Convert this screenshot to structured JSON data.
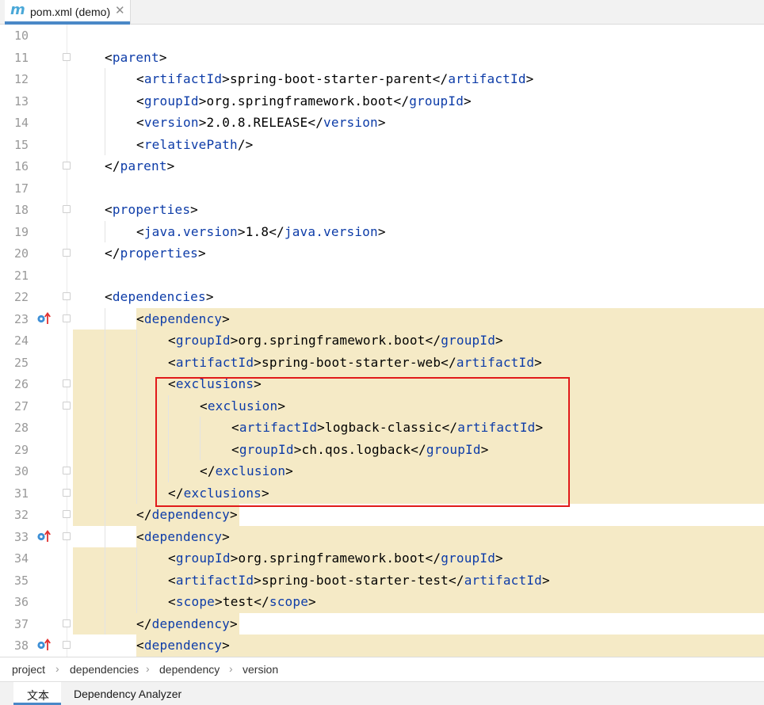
{
  "tab": {
    "icon": "maven-m-icon",
    "icon_glyph": "m",
    "title": "pom.xml (demo)",
    "close_glyph": "✕",
    "accent": "#4a88c7"
  },
  "colors": {
    "tag": "#0d3ca8",
    "text": "#000000",
    "highlight": "#f5eac6",
    "line_number": "#999999",
    "annotation_box": "#e11a1a"
  },
  "lines": [
    {
      "n": "10",
      "indent": 0,
      "parts": []
    },
    {
      "n": "11",
      "indent": 1,
      "parts": [
        {
          "c": "p",
          "v": "<"
        },
        {
          "c": "t",
          "v": "parent"
        },
        {
          "c": "p",
          "v": ">"
        }
      ]
    },
    {
      "n": "12",
      "indent": 2,
      "parts": [
        {
          "c": "p",
          "v": "<"
        },
        {
          "c": "t",
          "v": "artifactId"
        },
        {
          "c": "p",
          "v": ">"
        },
        {
          "c": "x",
          "v": "spring-boot-starter-parent"
        },
        {
          "c": "p",
          "v": "</"
        },
        {
          "c": "t",
          "v": "artifactId"
        },
        {
          "c": "p",
          "v": ">"
        }
      ]
    },
    {
      "n": "13",
      "indent": 2,
      "parts": [
        {
          "c": "p",
          "v": "<"
        },
        {
          "c": "t",
          "v": "groupId"
        },
        {
          "c": "p",
          "v": ">"
        },
        {
          "c": "x",
          "v": "org.springframework.boot"
        },
        {
          "c": "p",
          "v": "</"
        },
        {
          "c": "t",
          "v": "groupId"
        },
        {
          "c": "p",
          "v": ">"
        }
      ]
    },
    {
      "n": "14",
      "indent": 2,
      "parts": [
        {
          "c": "p",
          "v": "<"
        },
        {
          "c": "t",
          "v": "version"
        },
        {
          "c": "p",
          "v": ">"
        },
        {
          "c": "x",
          "v": "2.0.8.RELEASE"
        },
        {
          "c": "p",
          "v": "</"
        },
        {
          "c": "t",
          "v": "version"
        },
        {
          "c": "p",
          "v": ">"
        }
      ]
    },
    {
      "n": "15",
      "indent": 2,
      "parts": [
        {
          "c": "p",
          "v": "<"
        },
        {
          "c": "t",
          "v": "relativePath"
        },
        {
          "c": "p",
          "v": "/>"
        }
      ]
    },
    {
      "n": "16",
      "indent": 1,
      "parts": [
        {
          "c": "p",
          "v": "</"
        },
        {
          "c": "t",
          "v": "parent"
        },
        {
          "c": "p",
          "v": ">"
        }
      ]
    },
    {
      "n": "17",
      "indent": 0,
      "parts": []
    },
    {
      "n": "18",
      "indent": 1,
      "parts": [
        {
          "c": "p",
          "v": "<"
        },
        {
          "c": "t",
          "v": "properties"
        },
        {
          "c": "p",
          "v": ">"
        }
      ]
    },
    {
      "n": "19",
      "indent": 2,
      "parts": [
        {
          "c": "p",
          "v": "<"
        },
        {
          "c": "t",
          "v": "java.version"
        },
        {
          "c": "p",
          "v": ">"
        },
        {
          "c": "x",
          "v": "1.8"
        },
        {
          "c": "p",
          "v": "</"
        },
        {
          "c": "t",
          "v": "java.version"
        },
        {
          "c": "p",
          "v": ">"
        }
      ]
    },
    {
      "n": "20",
      "indent": 1,
      "parts": [
        {
          "c": "p",
          "v": "</"
        },
        {
          "c": "t",
          "v": "properties"
        },
        {
          "c": "p",
          "v": ">"
        }
      ]
    },
    {
      "n": "21",
      "indent": 0,
      "parts": []
    },
    {
      "n": "22",
      "indent": 1,
      "parts": [
        {
          "c": "p",
          "v": "<"
        },
        {
          "c": "t",
          "v": "dependencies"
        },
        {
          "c": "p",
          "v": ">"
        }
      ]
    },
    {
      "n": "23",
      "indent": 2,
      "parts": [
        {
          "c": "p",
          "v": "<"
        },
        {
          "c": "t",
          "v": "dependency"
        },
        {
          "c": "p",
          "v": ">"
        }
      ]
    },
    {
      "n": "24",
      "indent": 3,
      "parts": [
        {
          "c": "p",
          "v": "<"
        },
        {
          "c": "t",
          "v": "groupId"
        },
        {
          "c": "p",
          "v": ">"
        },
        {
          "c": "x",
          "v": "org.springframework.boot"
        },
        {
          "c": "p",
          "v": "</"
        },
        {
          "c": "t",
          "v": "groupId"
        },
        {
          "c": "p",
          "v": ">"
        }
      ]
    },
    {
      "n": "25",
      "indent": 3,
      "parts": [
        {
          "c": "p",
          "v": "<"
        },
        {
          "c": "t",
          "v": "artifactId"
        },
        {
          "c": "p",
          "v": ">"
        },
        {
          "c": "x",
          "v": "spring-boot-starter-web"
        },
        {
          "c": "p",
          "v": "</"
        },
        {
          "c": "t",
          "v": "artifactId"
        },
        {
          "c": "p",
          "v": ">"
        }
      ]
    },
    {
      "n": "26",
      "indent": 3,
      "parts": [
        {
          "c": "p",
          "v": "<"
        },
        {
          "c": "t",
          "v": "exclusions"
        },
        {
          "c": "p",
          "v": ">"
        }
      ]
    },
    {
      "n": "27",
      "indent": 4,
      "parts": [
        {
          "c": "p",
          "v": "<"
        },
        {
          "c": "t",
          "v": "exclusion"
        },
        {
          "c": "p",
          "v": ">"
        }
      ]
    },
    {
      "n": "28",
      "indent": 5,
      "parts": [
        {
          "c": "p",
          "v": "<"
        },
        {
          "c": "t",
          "v": "artifactId"
        },
        {
          "c": "p",
          "v": ">"
        },
        {
          "c": "x",
          "v": "logback-classic"
        },
        {
          "c": "p",
          "v": "</"
        },
        {
          "c": "t",
          "v": "artifactId"
        },
        {
          "c": "p",
          "v": ">"
        }
      ]
    },
    {
      "n": "29",
      "indent": 5,
      "parts": [
        {
          "c": "p",
          "v": "<"
        },
        {
          "c": "t",
          "v": "groupId"
        },
        {
          "c": "p",
          "v": ">"
        },
        {
          "c": "x",
          "v": "ch.qos.logback"
        },
        {
          "c": "p",
          "v": "</"
        },
        {
          "c": "t",
          "v": "groupId"
        },
        {
          "c": "p",
          "v": ">"
        }
      ]
    },
    {
      "n": "30",
      "indent": 4,
      "parts": [
        {
          "c": "p",
          "v": "</"
        },
        {
          "c": "t",
          "v": "exclusion"
        },
        {
          "c": "p",
          "v": ">"
        }
      ]
    },
    {
      "n": "31",
      "indent": 3,
      "parts": [
        {
          "c": "p",
          "v": "</"
        },
        {
          "c": "t",
          "v": "exclusions"
        },
        {
          "c": "p",
          "v": ">"
        }
      ]
    },
    {
      "n": "32",
      "indent": 2,
      "parts": [
        {
          "c": "p",
          "v": "</"
        },
        {
          "c": "t",
          "v": "dependency"
        },
        {
          "c": "p",
          "v": ">"
        }
      ]
    },
    {
      "n": "33",
      "indent": 2,
      "parts": [
        {
          "c": "p",
          "v": "<"
        },
        {
          "c": "t",
          "v": "dependency"
        },
        {
          "c": "p",
          "v": ">"
        }
      ]
    },
    {
      "n": "34",
      "indent": 3,
      "parts": [
        {
          "c": "p",
          "v": "<"
        },
        {
          "c": "t",
          "v": "groupId"
        },
        {
          "c": "p",
          "v": ">"
        },
        {
          "c": "x",
          "v": "org.springframework.boot"
        },
        {
          "c": "p",
          "v": "</"
        },
        {
          "c": "t",
          "v": "groupId"
        },
        {
          "c": "p",
          "v": ">"
        }
      ]
    },
    {
      "n": "35",
      "indent": 3,
      "parts": [
        {
          "c": "p",
          "v": "<"
        },
        {
          "c": "t",
          "v": "artifactId"
        },
        {
          "c": "p",
          "v": ">"
        },
        {
          "c": "x",
          "v": "spring-boot-starter-test"
        },
        {
          "c": "p",
          "v": "</"
        },
        {
          "c": "t",
          "v": "artifactId"
        },
        {
          "c": "p",
          "v": ">"
        }
      ]
    },
    {
      "n": "36",
      "indent": 3,
      "parts": [
        {
          "c": "p",
          "v": "<"
        },
        {
          "c": "t",
          "v": "scope"
        },
        {
          "c": "p",
          "v": ">"
        },
        {
          "c": "x",
          "v": "test"
        },
        {
          "c": "p",
          "v": "</"
        },
        {
          "c": "t",
          "v": "scope"
        },
        {
          "c": "p",
          "v": ">"
        }
      ]
    },
    {
      "n": "37",
      "indent": 2,
      "parts": [
        {
          "c": "p",
          "v": "</"
        },
        {
          "c": "t",
          "v": "dependency"
        },
        {
          "c": "p",
          "v": ">"
        }
      ]
    },
    {
      "n": "38",
      "indent": 2,
      "parts": [
        {
          "c": "p",
          "v": "<"
        },
        {
          "c": "t",
          "v": "dependency"
        },
        {
          "c": "p",
          "v": ">"
        }
      ]
    }
  ],
  "fold_markers": [
    "11",
    "16",
    "18",
    "20",
    "22",
    "23",
    "26",
    "27",
    "30",
    "31",
    "32",
    "33",
    "37",
    "38"
  ],
  "gutter_icons": {
    "23": "overrides-dependency-icon",
    "33": "overrides-dependency-icon",
    "38": "overrides-dependency-icon"
  },
  "highlighted_lines": [
    "23",
    "24",
    "25",
    "26",
    "27",
    "28",
    "29",
    "30",
    "31",
    "32",
    "33",
    "34",
    "35",
    "36",
    "37",
    "38"
  ],
  "annotation": {
    "label": "red-annotation-box",
    "lines": [
      "26",
      "31"
    ]
  },
  "breadcrumb": {
    "items": [
      "project",
      "dependencies",
      "dependency",
      "version"
    ],
    "separator": "›"
  },
  "bottom_tabs": {
    "items": [
      "文本",
      "Dependency Analyzer"
    ],
    "active": 0
  }
}
